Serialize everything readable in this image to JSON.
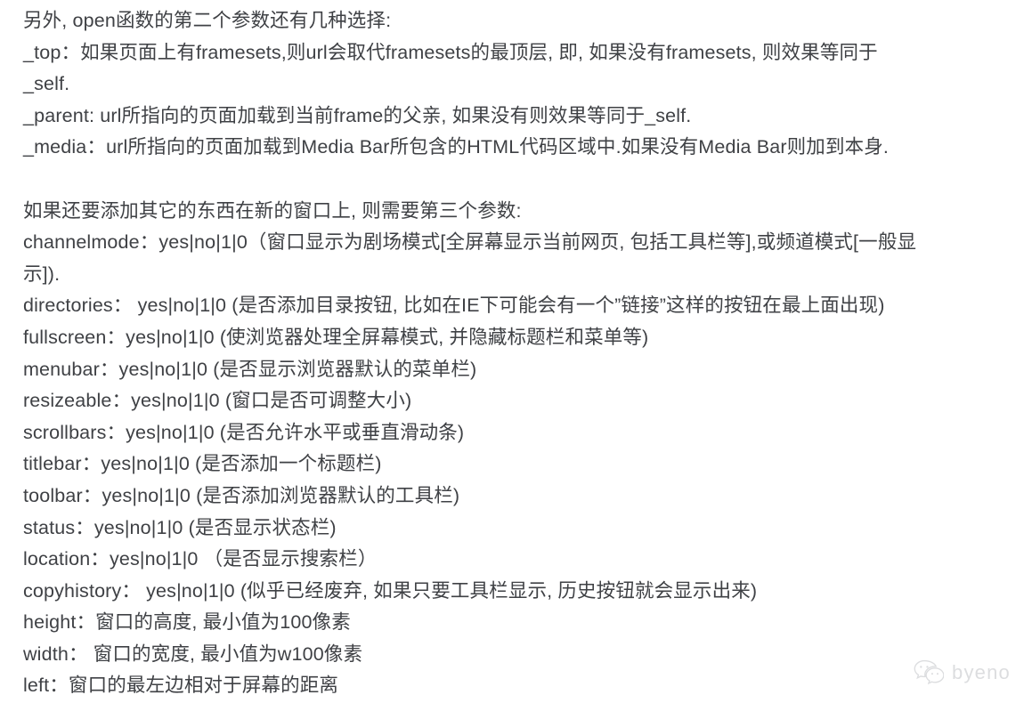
{
  "document": {
    "text_color": "#3f4145",
    "background_color": "#ffffff",
    "blocks": [
      {
        "id": "intro",
        "lines": [
          "另外, open函数的第二个参数还有几种选择:",
          "_top：如果页面上有framesets,则url会取代framesets的最顶层, 即, 如果没有framesets, 则效果等同于",
          "_self.",
          "_parent: url所指向的页面加载到当前frame的父亲, 如果没有则效果等同于_self.",
          "_media：url所指向的页面加载到Media Bar所包含的HTML代码区域中.如果没有Media Bar则加到本身."
        ]
      },
      {
        "id": "third-param",
        "lines": [
          "如果还要添加其它的东西在新的窗口上, 则需要第三个参数:",
          "channelmode：yes|no|1|0（窗口显示为剧场模式[全屏幕显示当前网页, 包括工具栏等],或频道模式[一般显",
          "示]).",
          "directories： yes|no|1|0 (是否添加目录按钮, 比如在IE下可能会有一个”链接”这样的按钮在最上面出现)",
          "fullscreen：yes|no|1|0 (使浏览器处理全屏幕模式, 并隐藏标题栏和菜单等)",
          "menubar：yes|no|1|0 (是否显示浏览器默认的菜单栏)",
          "resizeable：yes|no|1|0 (窗口是否可调整大小)",
          "scrollbars：yes|no|1|0 (是否允许水平或垂直滑动条)",
          "titlebar：yes|no|1|0 (是否添加一个标题栏)",
          "toolbar：yes|no|1|0 (是否添加浏览器默认的工具栏)",
          "status：yes|no|1|0 (是否显示状态栏)",
          "location：yes|no|1|0 （是否显示搜索栏）",
          "copyhistory： yes|no|1|0 (似乎已经废弃, 如果只要工具栏显示, 历史按钮就会显示出来)",
          "height：窗口的高度, 最小值为100像素",
          "width： 窗口的宽度, 最小值为w100像素",
          "left：窗口的最左边相对于屏幕的距离"
        ]
      }
    ]
  },
  "watermark": {
    "icon": "wechat-icon",
    "label": "byeno"
  }
}
